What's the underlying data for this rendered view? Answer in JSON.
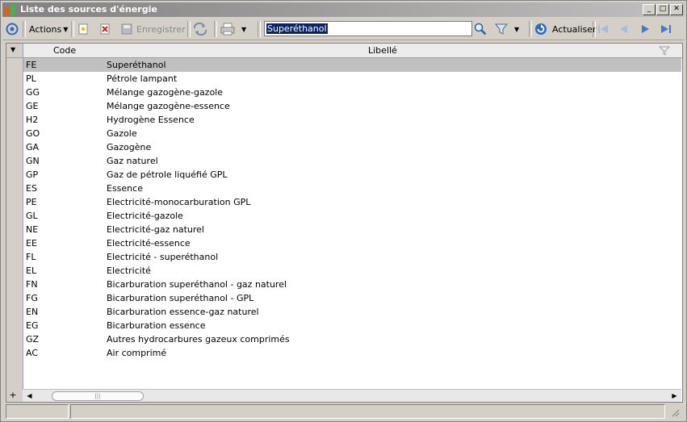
{
  "window": {
    "title": "Liste des sources d'énergie",
    "controls": {
      "minimize": "_",
      "maximize": "□",
      "close": "✕"
    }
  },
  "toolbar": {
    "actions_label": "Actions",
    "save_label": "Enregistrer",
    "search_value": "Superéthanol",
    "refresh_label": "Actualiser"
  },
  "grid": {
    "columns": [
      "Code",
      "Libellé"
    ],
    "selected_index": 0,
    "rows": [
      {
        "code": "FE",
        "label": "Superéthanol"
      },
      {
        "code": "PL",
        "label": "Pétrole lampant"
      },
      {
        "code": "GG",
        "label": "Mélange gazogène-gazole"
      },
      {
        "code": "GE",
        "label": "Mélange gazogène-essence"
      },
      {
        "code": "H2",
        "label": "Hydrogène Essence"
      },
      {
        "code": "GO",
        "label": "Gazole"
      },
      {
        "code": "GA",
        "label": "Gazogène"
      },
      {
        "code": "GN",
        "label": "Gaz naturel"
      },
      {
        "code": "GP",
        "label": "Gaz de pétrole liquéfié GPL"
      },
      {
        "code": "ES",
        "label": "Essence"
      },
      {
        "code": "PE",
        "label": "Electricité-monocarburation GPL"
      },
      {
        "code": "GL",
        "label": "Electricité-gazole"
      },
      {
        "code": "NE",
        "label": "Electricité-gaz naturel"
      },
      {
        "code": "EE",
        "label": "Electricité-essence"
      },
      {
        "code": "FL",
        "label": "Electricité - superéthanol"
      },
      {
        "code": "EL",
        "label": "Electricité"
      },
      {
        "code": "FN",
        "label": "Bicarburation superéthanol - gaz naturel"
      },
      {
        "code": "FG",
        "label": "Bicarburation superéthanol - GPL"
      },
      {
        "code": "EN",
        "label": "Bicarburation essence-gaz naturel"
      },
      {
        "code": "EG",
        "label": "Bicarburation essence"
      },
      {
        "code": "GZ",
        "label": "Autres hydrocarbures gazeux comprimés"
      },
      {
        "code": "AC",
        "label": "Air comprimé"
      }
    ]
  },
  "colors": {
    "title_gradient_start": "#808080",
    "selection_highlight": "#0a246a",
    "selected_row": "#c0c0c0",
    "nav_blue": "#3a7bd5"
  }
}
